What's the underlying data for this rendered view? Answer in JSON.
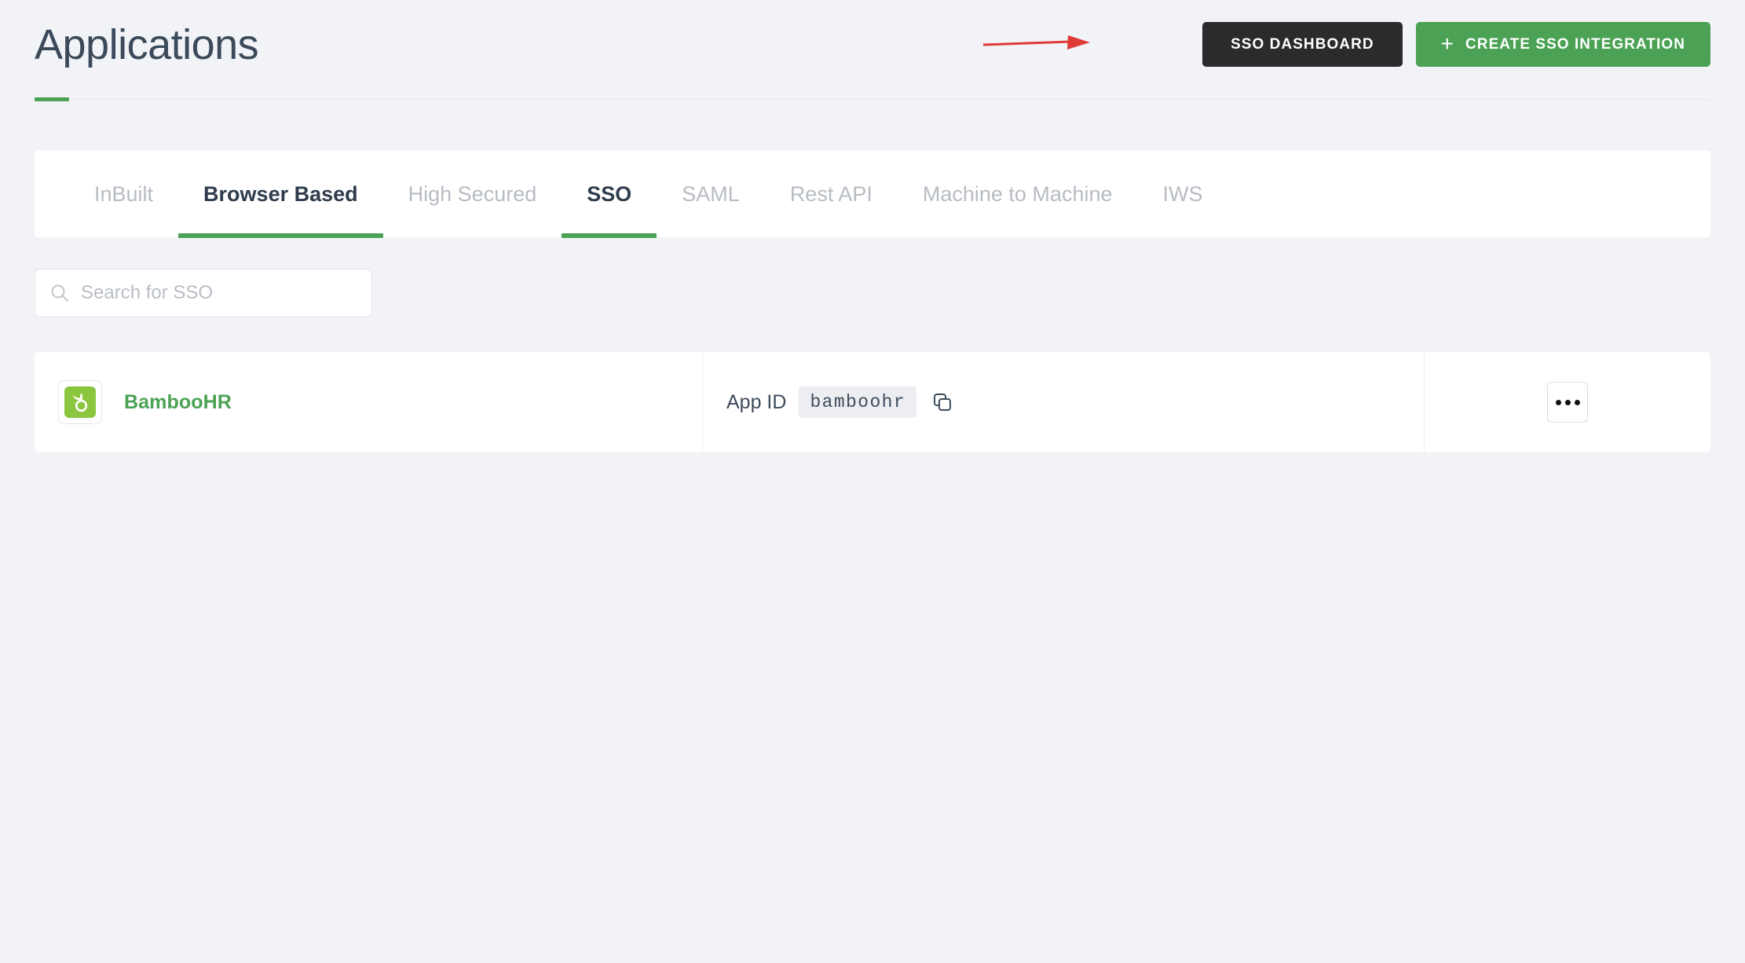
{
  "header": {
    "title": "Applications",
    "accent_color": "#4ba254",
    "title_color": "#3b4a5a",
    "buttons": {
      "sso_dashboard": {
        "label": "SSO DASHBOARD",
        "bg": "#2b2b2d"
      },
      "create_integration": {
        "label": "CREATE SSO INTEGRATION",
        "bg": "#4ba254",
        "icon": "plus-icon",
        "plus": "+"
      }
    },
    "annotation": {
      "type": "arrow",
      "color": "#e03a36",
      "points_to": "SSO DASHBOARD"
    }
  },
  "tabs": {
    "items": [
      {
        "label": "InBuilt",
        "active": false
      },
      {
        "label": "Browser Based",
        "active": true
      },
      {
        "label": "High Secured",
        "active": false
      },
      {
        "label": "SSO",
        "active": true
      },
      {
        "label": "SAML",
        "active": false
      },
      {
        "label": "Rest API",
        "active": false
      },
      {
        "label": "Machine to Machine",
        "active": false
      },
      {
        "label": "IWS",
        "active": false
      }
    ],
    "active_color": "#2f3c4c",
    "inactive_color": "#b7bcc3",
    "underline_color": "#4ba254"
  },
  "search": {
    "placeholder": "Search for SSO",
    "value": "",
    "icon": "search-icon"
  },
  "app_list": {
    "rows": [
      {
        "name": "BambooHR",
        "name_color": "#4ba254",
        "logo": {
          "icon": "bamboohr-logo-icon",
          "bg": "#8cc63f"
        },
        "app_id_label": "App ID",
        "app_id_value": "bamboohr",
        "copy_icon": "copy-icon",
        "menu_icon": "kebab-menu-icon"
      }
    ]
  }
}
